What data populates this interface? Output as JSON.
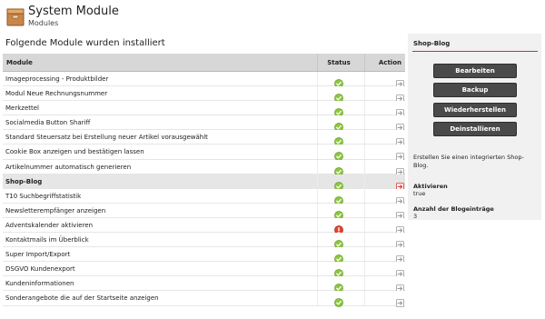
{
  "header": {
    "title": "System Module",
    "subtitle": "Modules"
  },
  "main": {
    "heading": "Folgende Module wurden installiert",
    "columns": {
      "module": "Module",
      "status": "Status",
      "action": "Action"
    },
    "rows": [
      {
        "name": "Imageprocessing - Produktbilder",
        "status": "ok",
        "active": false
      },
      {
        "name": "Modul Neue Rechnungsnummer",
        "status": "ok",
        "active": false
      },
      {
        "name": "Merkzettel",
        "status": "ok",
        "active": false
      },
      {
        "name": "Socialmedia Button Shariff",
        "status": "ok",
        "active": false
      },
      {
        "name": "Standard Steuersatz bei Erstellung neuer Artikel vorausgewählt",
        "status": "ok",
        "active": false
      },
      {
        "name": "Cookie Box anzeigen und bestätigen lassen",
        "status": "ok",
        "active": false
      },
      {
        "name": "Artikelnummer automatisch generieren",
        "status": "ok",
        "active": false
      },
      {
        "name": "Shop-Blog",
        "status": "ok",
        "active": true
      },
      {
        "name": "T10 Suchbegriffstatistik",
        "status": "ok",
        "active": false
      },
      {
        "name": "Newsletterempfänger anzeigen",
        "status": "ok",
        "active": false
      },
      {
        "name": "Adventskalender aktivieren",
        "status": "error",
        "active": false
      },
      {
        "name": "Kontaktmails im Überblick",
        "status": "ok",
        "active": false
      },
      {
        "name": "Super Import/Export",
        "status": "ok",
        "active": false
      },
      {
        "name": "DSGVO Kundenexport",
        "status": "ok",
        "active": false
      },
      {
        "name": "Kundeninformationen",
        "status": "ok",
        "active": false
      },
      {
        "name": "Sonderangebote die auf der Startseite anzeigen",
        "status": "ok",
        "active": false
      }
    ]
  },
  "panel": {
    "title": "Shop-Blog",
    "buttons": {
      "edit": "Bearbeiten",
      "backup": "Backup",
      "restore": "Wiederherstellen",
      "uninstall": "Deinstallieren"
    },
    "description": "Erstellen Sie einen integrierten Shop-Blog.",
    "properties": [
      {
        "label": "Aktivieren",
        "value": "true"
      },
      {
        "label": "Anzahl der Blogeinträge",
        "value": "3"
      }
    ]
  },
  "colors": {
    "status_ok": "#8cc63f",
    "status_error": "#e0442a",
    "action_default": "#9a9a9a",
    "action_active": "#d9342b",
    "panel_accent": "#c9302c",
    "button_bg": "#4a4a4a"
  },
  "icons": {
    "module": "box-icon",
    "status_ok": "check-circle-icon",
    "status_error": "exclamation-circle-icon",
    "action": "arrow-right-icon"
  }
}
